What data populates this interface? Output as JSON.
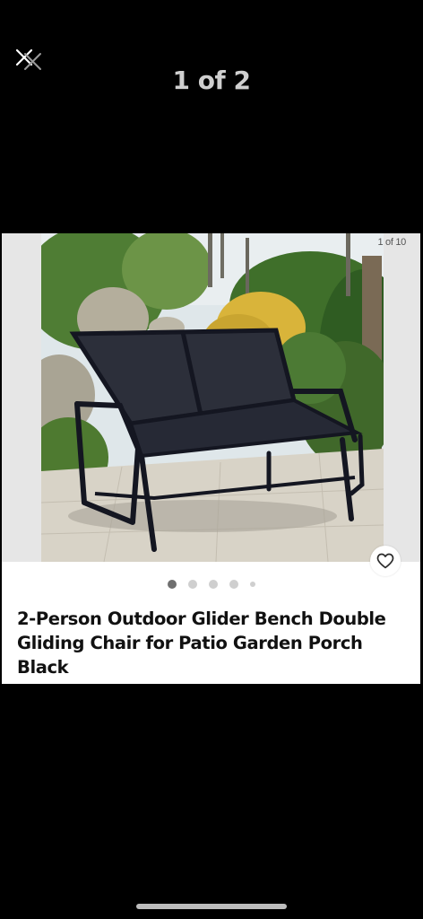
{
  "viewer": {
    "counter": "1 of 2",
    "close_icon": "close-icon"
  },
  "listing": {
    "photo_badge": "1 of 10",
    "title": "2-Person Outdoor Glider Bench Double Gliding Chair for Patio Garden Porch Black",
    "favorite_icon": "heart-icon",
    "pager_dots": 5,
    "active_dot": 1
  },
  "colors": {
    "background": "#000000",
    "card": "#ffffff",
    "dot_active": "#6f6f6f",
    "dot_inactive": "#cfcfcf"
  }
}
